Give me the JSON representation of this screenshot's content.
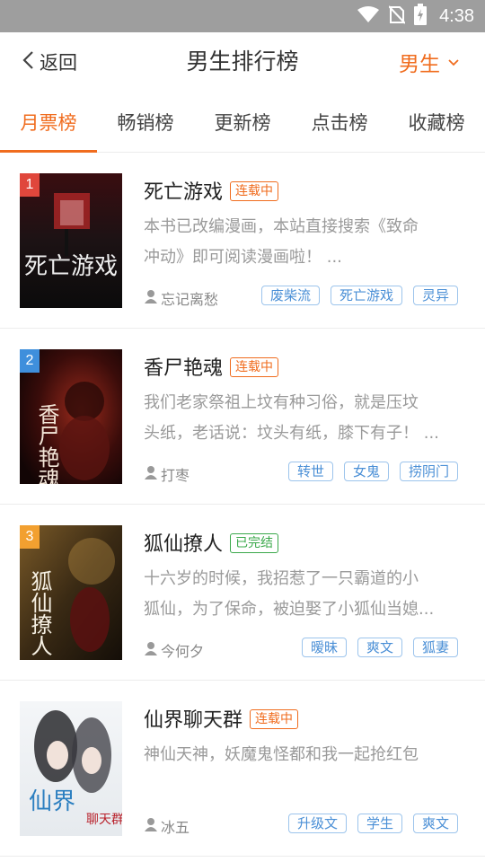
{
  "status_bar": {
    "time": "4:38"
  },
  "header": {
    "back_label": "返回",
    "title": "男生排行榜",
    "gender_label": "男生"
  },
  "tabs": [
    {
      "label": "月票榜",
      "active": true
    },
    {
      "label": "畅销榜",
      "active": false
    },
    {
      "label": "更新榜",
      "active": false
    },
    {
      "label": "点击榜",
      "active": false
    },
    {
      "label": "收藏榜",
      "active": false
    }
  ],
  "books": [
    {
      "rank": "1",
      "title": "死亡游戏",
      "status": "连载中",
      "desc_lines": [
        "本书已改编漫画，本站直接搜索《致命",
        "冲动》即可阅读漫画啦！ ..."
      ],
      "author": "忘记离愁",
      "tags": [
        "废柴流",
        "死亡游戏",
        "灵异"
      ],
      "cover_text": "死亡游戏",
      "rank_color": "#e0473c"
    },
    {
      "rank": "2",
      "title": "香尸艳魂",
      "status": "连载中",
      "desc_lines": [
        "我们老家祭祖上坟有种习俗，就是压坟",
        "头纸，老话说：坟头有纸，膝下有子！ ..."
      ],
      "author": "打枣",
      "tags": [
        "转世",
        "女鬼",
        "捞阴门"
      ],
      "cover_text": "香尸艳魂",
      "rank_color": "#3f8fdc"
    },
    {
      "rank": "3",
      "title": "狐仙撩人",
      "status": "已完结",
      "desc_lines": [
        "十六岁的时候，我招惹了一只霸道的小",
        "狐仙，为了保命，被迫娶了小狐仙当媳..."
      ],
      "author": "今何夕",
      "tags": [
        "暧昧",
        "爽文",
        "狐妻"
      ],
      "cover_text": "狐仙撩人",
      "rank_color": "#f2a030"
    },
    {
      "rank": "",
      "title": "仙界聊天群",
      "status": "连载中",
      "desc_lines": [
        "神仙天神，妖魔鬼怪都和我一起抢红包",
        ""
      ],
      "author": "冰五",
      "tags": [
        "升级文",
        "学生",
        "爽文"
      ],
      "cover_text": "仙界聊天群",
      "rank_color": ""
    }
  ]
}
